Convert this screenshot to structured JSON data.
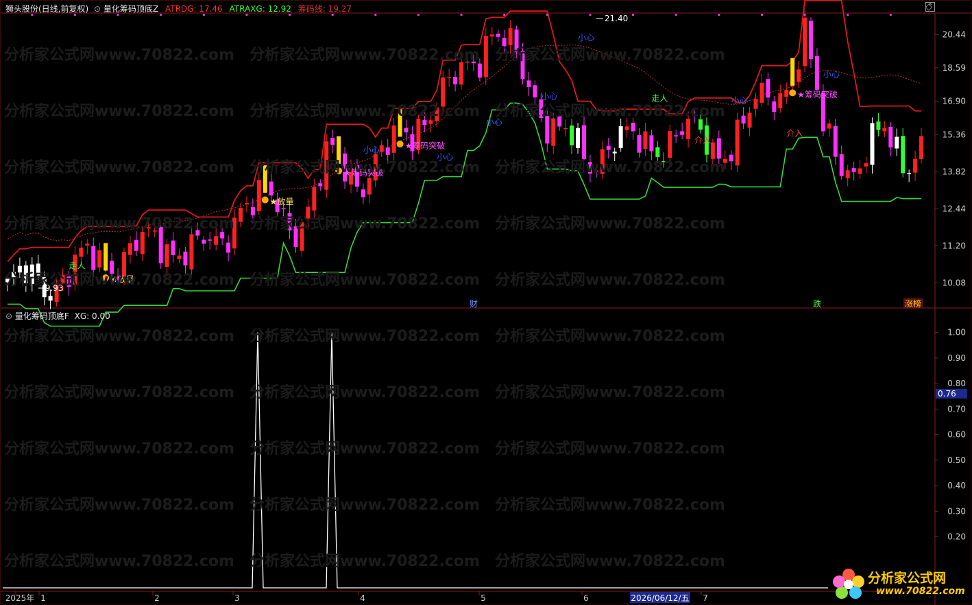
{
  "header": {
    "stock_title": "狮头股份(日线,前复权)",
    "indicator_name": "量化筹码顶底Z",
    "atrdg_label": "ATRDG:",
    "atrdg_value": "17.46",
    "atraxg_label": "ATRAXG:",
    "atraxg_value": "12.92",
    "chip_label": "筹码线:",
    "chip_value": "19.27"
  },
  "sub_header": {
    "indicator_name": "量化筹码顶底F",
    "xg_label": "XG:",
    "xg_value": "0.00"
  },
  "watermark": "分析家公式网www.70822.com",
  "brand": {
    "name": "分析家公式网",
    "url": "www.70822.com"
  },
  "colors": {
    "up": "#ff2020",
    "down": "#ff30ff",
    "white": "#ffffff",
    "green": "#30ff30",
    "yellow": "#ffd800",
    "upper_band": "#e01818",
    "lower_band": "#36d836",
    "dotted_line": "#c03030",
    "axis": "#8b1a1a"
  },
  "chart_data": [
    {
      "type": "candlestick",
      "y_ticks": [
        "20.44",
        "18.59",
        "16.90",
        "15.36",
        "13.82",
        "12.44",
        "11.20",
        "10.08"
      ],
      "ylim": [
        9.7,
        21.6
      ],
      "x_labels": [
        "2025年",
        "1",
        "2",
        "3",
        "4",
        "5",
        "6",
        "2026/06/12/五",
        "7"
      ],
      "high_label": "21.40",
      "low_label": "9.93",
      "event_markers": [
        "财",
        "跌",
        "涨榜"
      ],
      "annotations": {
        "volume": "★放量",
        "chip_break": "★筹码突破",
        "exit": "走人",
        "enter": "介入",
        "small": "小心"
      }
    },
    {
      "type": "line",
      "series": [
        {
          "name": "XG",
          "values": [
            0,
            1,
            0,
            1,
            0
          ]
        }
      ],
      "y_ticks": [
        "1.00",
        "0.90",
        "0.80",
        "0.70",
        "0.60",
        "0.50",
        "0.40",
        "0.30",
        "0.20"
      ],
      "ylim": [
        0,
        1.05
      ],
      "cursor_value": "0.76"
    }
  ]
}
